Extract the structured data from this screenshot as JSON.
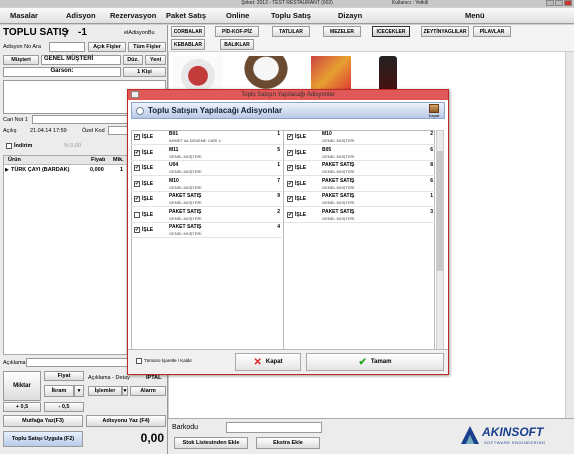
{
  "titlebar": {
    "title": "Şirket: 2012 - TEST RESTAURANT (002)",
    "user": "Kullanıcı : Yetkili"
  },
  "menu": [
    "Masalar",
    "Adisyon",
    "Rezervasyon",
    "Paket Satış",
    "Online",
    "Toplu Satış",
    "Dizayn",
    "Menü"
  ],
  "left": {
    "mode_title": "TOPLU SATIŞ",
    "table_no": "-1",
    "adisyon_ara_label": "Adisyon No Ara",
    "acik_fisler": "Açık Fişler",
    "tum_fisler": "Tüm Fişler",
    "musteri_btn": "Müşteri",
    "musteri_name": "GENEL MÜŞTERİ",
    "duz_btn": "Düz.",
    "yeni_btn": "Yeni",
    "garson_label": "Garson:",
    "kisi_btn": "1 Kişi",
    "cari_not_label": "Cari Not 1",
    "acilis_label": "Açılış",
    "acilis_value": "21.04.14 17:59",
    "ozel_kod_label": "Özel Kod",
    "indirim_label": "İndirim",
    "indirim_value": "% 0,00",
    "col_urun": "Ürün",
    "col_fiyat": "Fiyatı",
    "col_mik": "Mik.",
    "item_name": "TÜRK ÇAYI (BARDAK)",
    "item_price": "0,000",
    "item_qty": "1",
    "aciklama_label": "Açıklama",
    "miktar_btn": "Miktar",
    "fiyat_btn": "Fiyat",
    "ikram_btn": "İkram",
    "plus_btn": "+ 0,5",
    "minus_btn": "- 0,5",
    "aciklama_detay": "Açıklama - Detay",
    "iptal_btn": "İPTAL",
    "islemler_btn": "İşlemler",
    "alarm_btn": "Alarm",
    "mutfaga_btn": "Mutfağa Yaz(F3)",
    "adisyonu_btn": "Adisyonu Yaz (F4)",
    "toplu_btn": "Toplu Satışı Uygula (F2)",
    "total": "0,00"
  },
  "top": {
    "adisyon_bu": "elAdisyonBu"
  },
  "categories_row1": [
    "CORBALAR",
    "PİD-KOF-PİZ",
    "TATLILAR",
    "MEZELER",
    "ICECEKLER",
    "ZEYTİNYAGLILAR",
    "PİLAVLAR"
  ],
  "categories_row2": [
    "KEBABLAR",
    "BALIKLAR"
  ],
  "dialog": {
    "titlebar": "Toplu Satışın Yapılacağı Adisyonlar",
    "header": "Toplu Satışın Yapılacağı Adisyonlar",
    "kapat_small": "Kapat",
    "select_all": "Tümünü İşaretle / Kaldır",
    "kapat_btn": "Kapat",
    "tamam_btn": "Tamam",
    "left_rows": [
      {
        "checked": true,
        "label": "İŞLE",
        "name": "B01",
        "sub": "AHMET Ak DENEME CARİ 4",
        "num": "1"
      },
      {
        "checked": true,
        "label": "İŞLE",
        "name": "M11",
        "sub": "GENEL MÜŞTERİ",
        "num": "5"
      },
      {
        "checked": true,
        "label": "İŞLE",
        "name": "U04",
        "sub": "GENEL MÜŞTERİ",
        "num": "1"
      },
      {
        "checked": true,
        "label": "İŞLE",
        "name": "M10",
        "sub": "GENEL MÜŞTERİ",
        "num": "7"
      },
      {
        "checked": true,
        "label": "İŞLE",
        "name": "PAKET SATIŞ",
        "sub": "GENEL MÜŞTERİ",
        "num": "9"
      },
      {
        "checked": false,
        "label": "İŞLE",
        "name": "PAKET SATIŞ",
        "sub": "GENEL MÜŞTERİ",
        "num": "2"
      },
      {
        "checked": true,
        "label": "İŞLE",
        "name": "PAKET SATIŞ",
        "sub": "GENEL MÜŞTERİ",
        "num": "4"
      }
    ],
    "right_rows": [
      {
        "checked": true,
        "label": "İŞLE",
        "name": "M10",
        "sub": "GENEL MÜŞTERİ",
        "num": "2"
      },
      {
        "checked": true,
        "label": "İŞLE",
        "name": "B05",
        "sub": "GENEL MÜŞTERİ",
        "num": "6"
      },
      {
        "checked": true,
        "label": "İŞLE",
        "name": "PAKET SATIŞ",
        "sub": "GENEL MÜŞTERİ",
        "num": "8"
      },
      {
        "checked": true,
        "label": "İŞLE",
        "name": "PAKET SATIŞ",
        "sub": "GENEL MÜŞTERİ",
        "num": "6"
      },
      {
        "checked": true,
        "label": "İŞLE",
        "name": "PAKET SATIŞ",
        "sub": "GENEL MÜŞTERİ",
        "num": "1"
      },
      {
        "checked": true,
        "label": "İŞLE",
        "name": "PAKET SATIŞ",
        "sub": "GENEL MÜŞTERİ",
        "num": "3"
      }
    ]
  },
  "bottom": {
    "barkodu_label": "Barkodu",
    "stok_btn": "Stok Listesinden Ekle",
    "ekstra_btn": "Ekstra Ekle"
  },
  "brand": {
    "name": "AKINSOFT",
    "tagline": "SOFTWARE ENGINEERING",
    "color": "#1a3f8c"
  }
}
